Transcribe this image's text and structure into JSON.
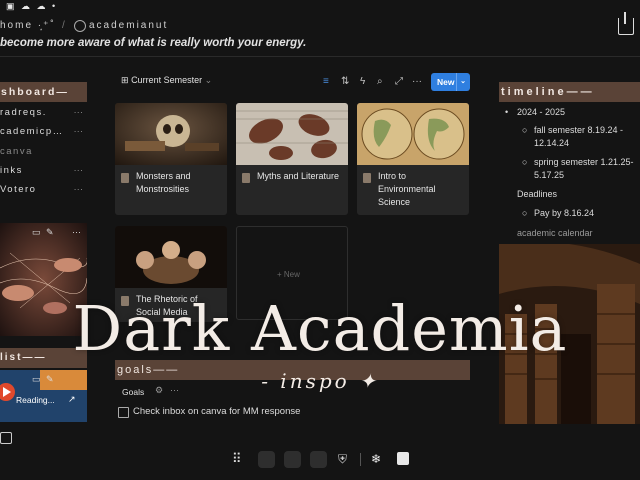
{
  "breadcrumb": {
    "home": "home ·͙⁺˚",
    "separator": "/",
    "page": "academianut"
  },
  "quote": "become more aware of what is really worth your energy.",
  "sidebar": {
    "dashboard_header": "shboard—",
    "items": [
      {
        "label": "radreqs."
      },
      {
        "label": "cademicp…"
      },
      {
        "label": "canva"
      },
      {
        "label": "inks"
      },
      {
        "label": "Votero"
      }
    ],
    "list_header": "list——",
    "reading_label": "Reading..."
  },
  "gallery": {
    "view_label": "Current Semester",
    "new_label": "New",
    "cards": [
      {
        "title": "Monsters and Monstrosities"
      },
      {
        "title": "Myths and Literature"
      },
      {
        "title": "Intro to Environmental Science"
      },
      {
        "title": "The Rhetoric of Social Media"
      }
    ],
    "new_card_label": "+ New"
  },
  "goals": {
    "header": "goals——",
    "tab": "Goals",
    "todos": [
      {
        "text": "Check inbox on canva for MM response",
        "checked": false
      }
    ]
  },
  "timeline": {
    "header": "timeline——",
    "year": "2024 - 2025",
    "fall": "fall semester 8.19.24 - 12.14.24",
    "spring": "spring semester 1.21.25- 5.17.25",
    "deadlines": "Deadlines",
    "pay": "Pay by 8.16.24",
    "calendar": "academic calendar"
  },
  "overlay": {
    "title": "Dark Academia",
    "subtitle": "- inspo ✦"
  },
  "colors": {
    "accent_header": "#5a4337",
    "new_button": "#2f7fe0",
    "background": "#141414"
  }
}
